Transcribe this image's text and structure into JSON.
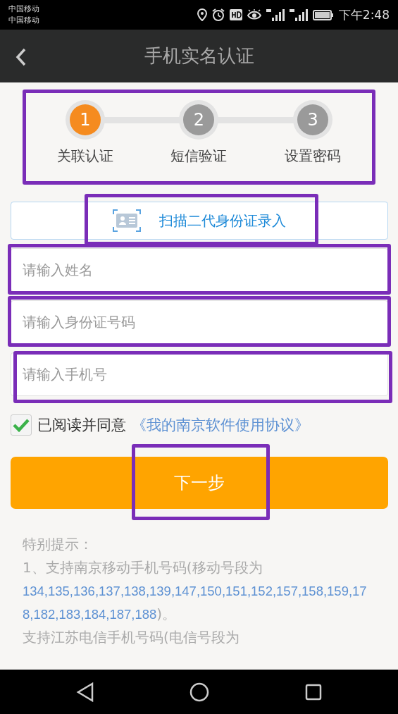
{
  "status_bar": {
    "carriers": [
      "中国移动",
      "中国移动"
    ],
    "time": "下午2:48"
  },
  "header": {
    "title": "手机实名认证"
  },
  "steps": {
    "highlighted": true,
    "items": [
      {
        "number": "1",
        "label": "关联认证",
        "selected": true
      },
      {
        "number": "2",
        "label": "短信验证",
        "selected": false
      },
      {
        "number": "3",
        "label": "设置密码",
        "selected": false
      }
    ]
  },
  "scan_button": {
    "label": "扫描二代身份证录入",
    "highlighted": true
  },
  "fields": [
    {
      "placeholder": "请输入姓名",
      "highlighted": true
    },
    {
      "placeholder": "请输入身份证号码",
      "highlighted": true
    },
    {
      "placeholder": "请输入手机号",
      "highlighted": true
    }
  ],
  "agreement": {
    "checked": true,
    "text": "已阅读并同意",
    "link": "《我的南京软件使用协议》"
  },
  "next_button": {
    "label": "下一步",
    "highlighted": true
  },
  "tips": {
    "title": "特别提示：",
    "notes": [
      {
        "prefix": "1、支持南京移动手机号码(移动号段为",
        "numbers": "134,135,136,137,138,139,147,150,151,152,157,158,159,178,182,183,184,187,188",
        "suffix": ")。"
      },
      {
        "prefix": "支持江苏电信手机号码(电信号段为"
      }
    ]
  }
}
